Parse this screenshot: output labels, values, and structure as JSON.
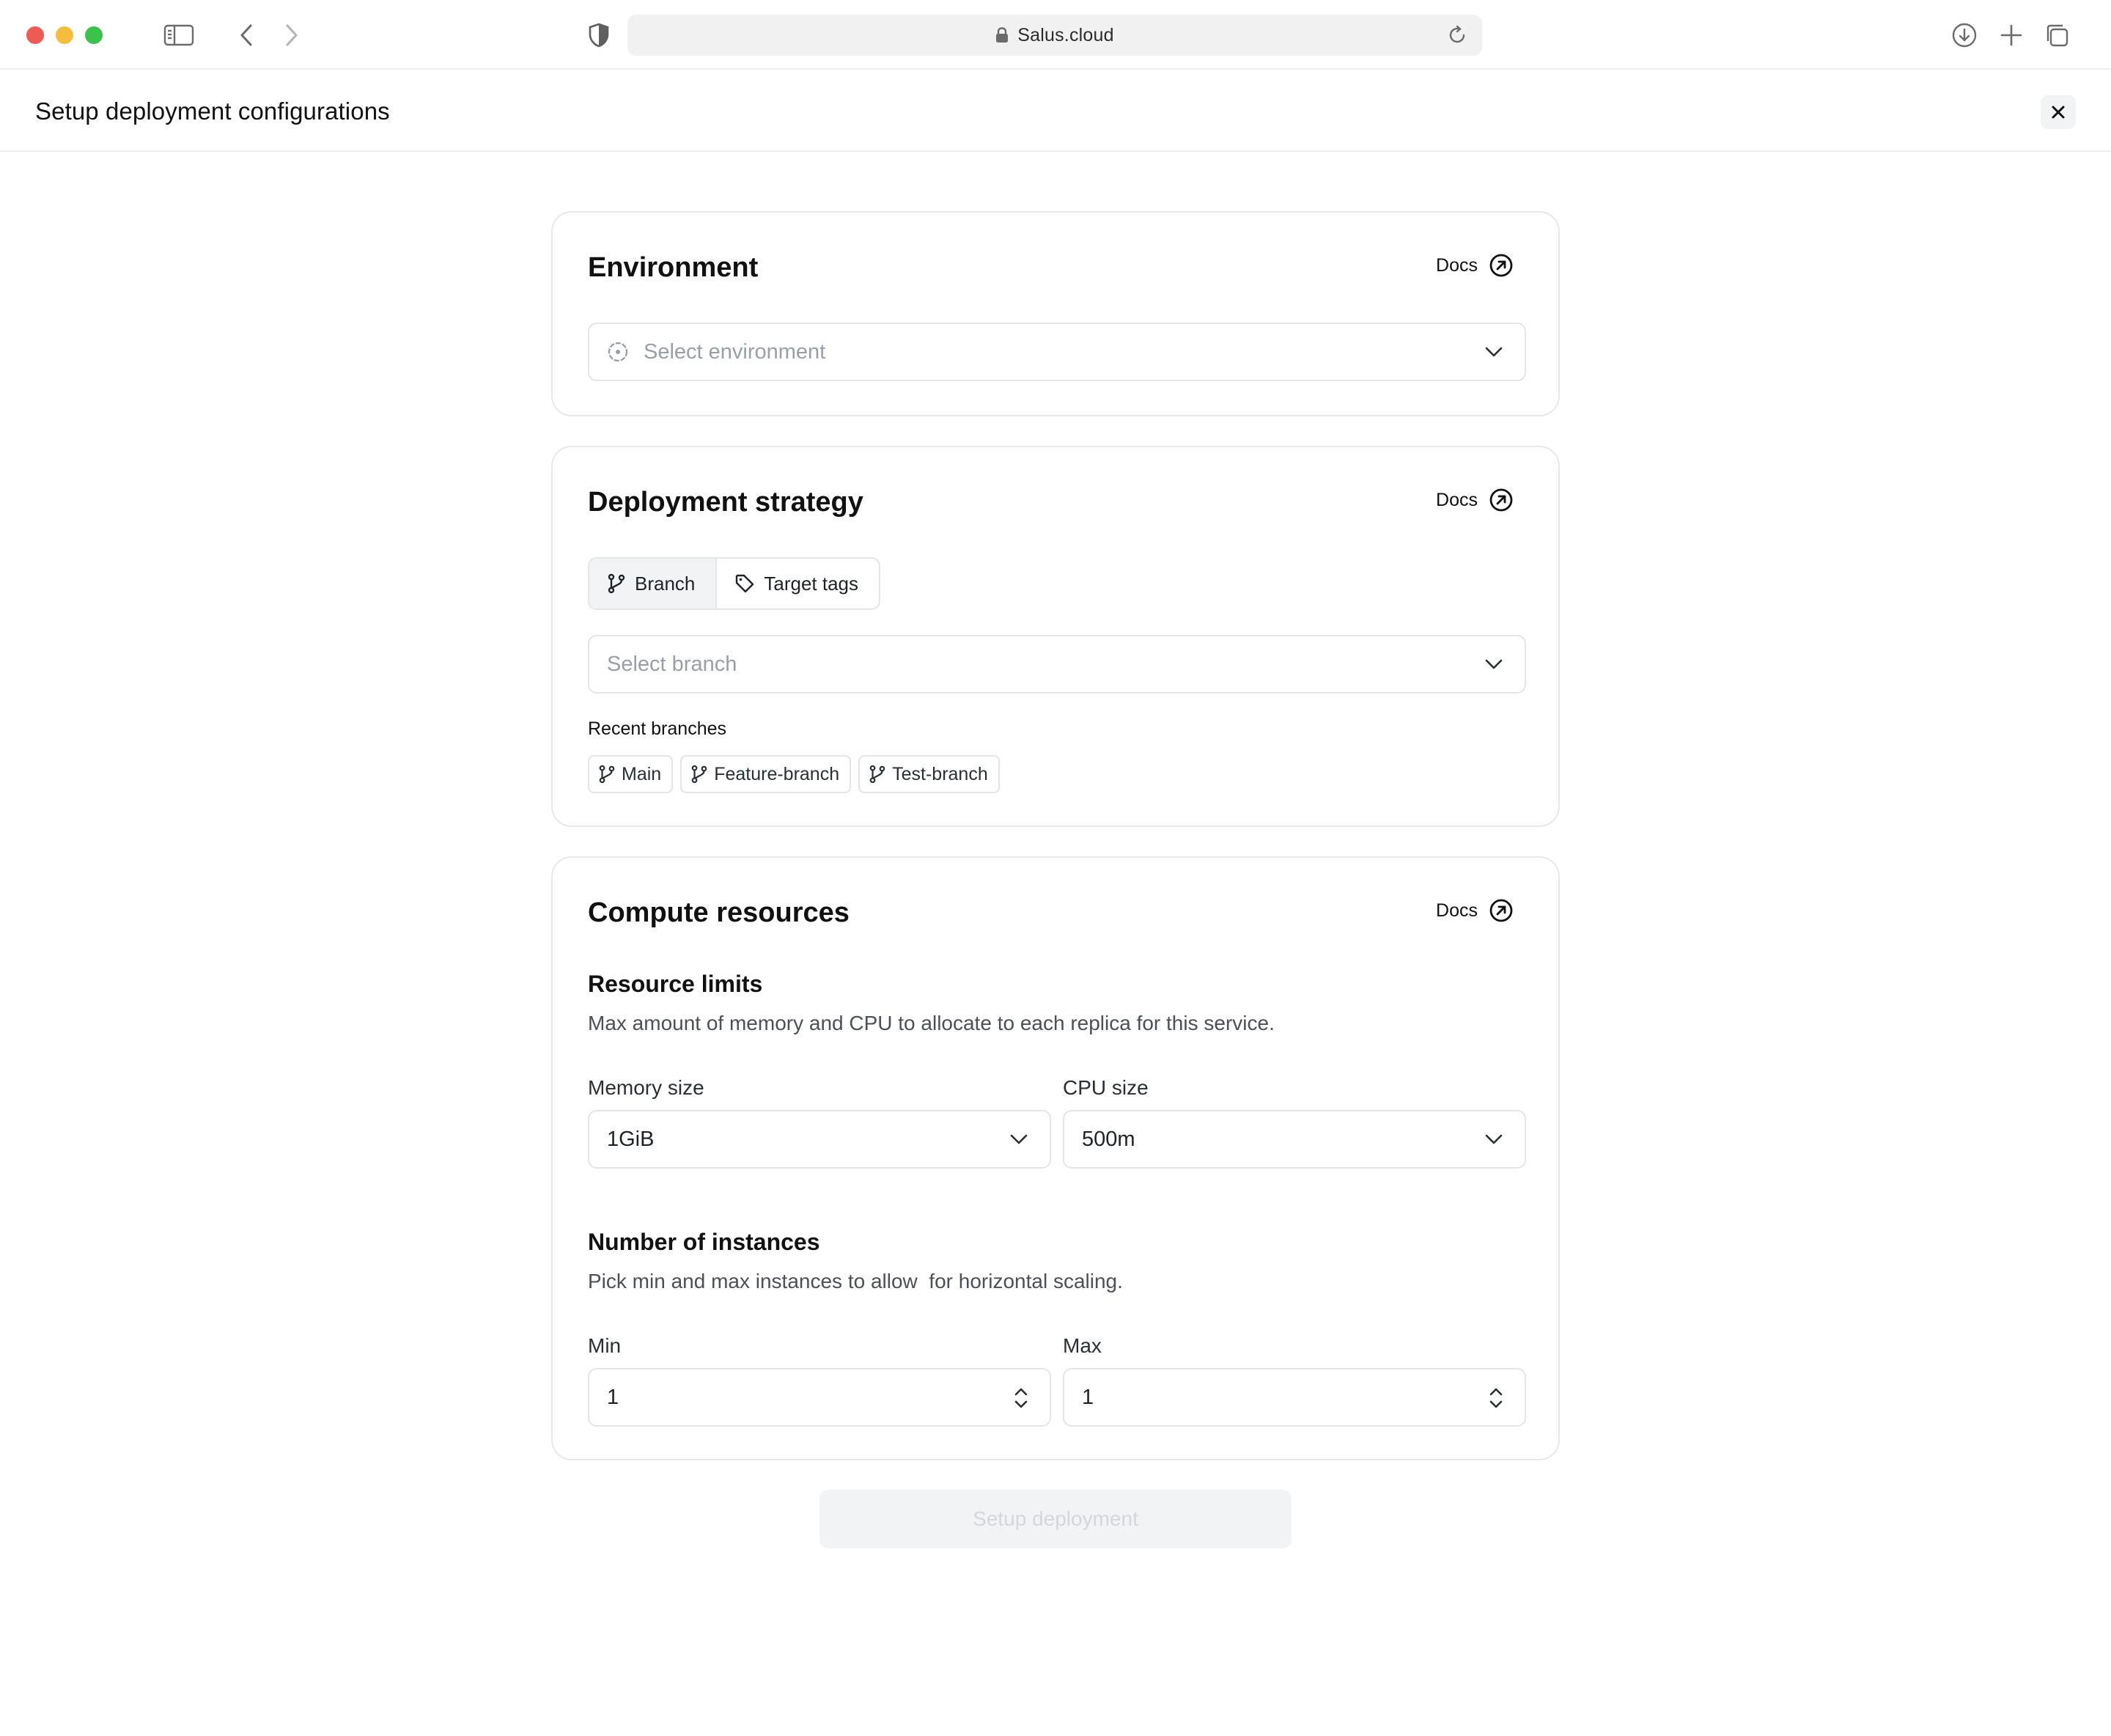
{
  "browser": {
    "url": "Salus.cloud",
    "traffic_colors": {
      "close": "#ee5b55",
      "minimize": "#f4bd3b",
      "zoom": "#3ac34b"
    }
  },
  "header": {
    "title": "Setup deployment configurations"
  },
  "environment": {
    "title": "Environment",
    "docs_label": "Docs",
    "select_placeholder": "Select environment"
  },
  "strategy": {
    "title": "Deployment strategy",
    "docs_label": "Docs",
    "tabs": [
      {
        "label": "Branch",
        "icon": "git-branch-icon",
        "active": true
      },
      {
        "label": "Target tags",
        "icon": "tag-icon",
        "active": false
      }
    ],
    "branch_placeholder": "Select branch",
    "recent_label": "Recent branches",
    "recent_branches": [
      "Main",
      "Feature-branch",
      "Test-branch"
    ]
  },
  "compute": {
    "title": "Compute resources",
    "docs_label": "Docs",
    "limits_title": "Resource limits",
    "limits_desc": "Max amount of memory and CPU to allocate to each replica for this service.",
    "memory_label": "Memory size",
    "memory_value": "1GiB",
    "cpu_label": "CPU size",
    "cpu_value": "500m",
    "instances_title": "Number of instances",
    "instances_desc": "Pick min and max instances to allow  for horizontal scaling.",
    "min_label": "Min",
    "min_value": "1",
    "max_label": "Max",
    "max_value": "1"
  },
  "actions": {
    "submit_label": "Setup deployment"
  }
}
